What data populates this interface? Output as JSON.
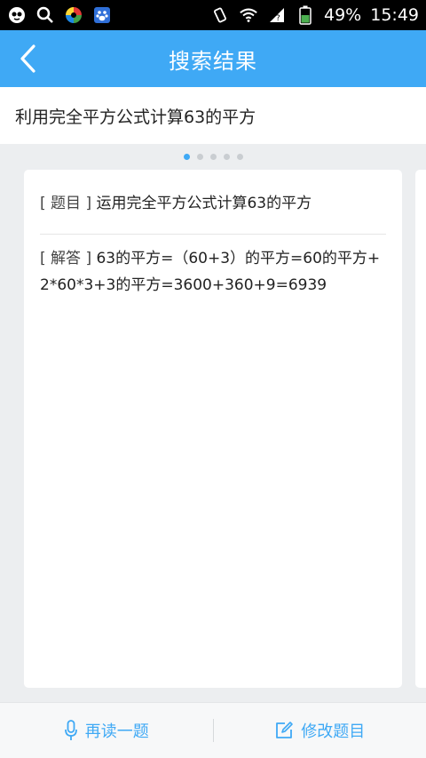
{
  "status_bar": {
    "battery": "49%",
    "time": "15:49"
  },
  "header": {
    "title": "搜索结果"
  },
  "query": {
    "text": "利用完全平方公式计算63的平方"
  },
  "pager": {
    "count": 5,
    "active": 0
  },
  "card": {
    "question_tag": "[ 题目 ]",
    "question_text": "运用完全平方公式计算63的平方",
    "answer_tag": "[ 解答 ]",
    "answer_text": "63的平方=（60+3）的平方=60的平方+2*60*3+3的平方=3600+360+9=6939"
  },
  "bottom": {
    "reread_label": "再读一题",
    "edit_label": "修改题目"
  },
  "colors": {
    "accent": "#3fa9f5",
    "background": "#eceef0"
  }
}
